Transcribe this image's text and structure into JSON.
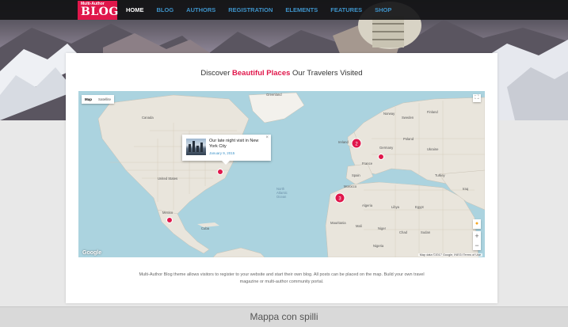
{
  "nav": {
    "logo_small": "Multi-Author",
    "logo_big": "BLOG",
    "items": [
      "HOME",
      "BLOG",
      "AUTHORS",
      "REGISTRATION",
      "ELEMENTS",
      "FEATURES",
      "SHOP"
    ]
  },
  "section": {
    "title_before": "Discover ",
    "title_highlight": "Beautiful Places",
    "title_after": " Our Travelers Visited"
  },
  "map": {
    "type_map": "Map",
    "type_satellite": "Satellite",
    "fullscreen_icon": "fullscreen-icon",
    "zoom_in": "+",
    "zoom_out": "−",
    "google_logo": "Google",
    "attribution": "Map data ©2017 Google, INEGI   Terms of Use",
    "labels": {
      "greenland": "Greenland",
      "canada": "Canada",
      "united_states": "United States",
      "mexico": "Mexico",
      "ocean": "North\nAtlantic\nOcean",
      "ireland": "Ireland",
      "germany": "Germany",
      "france": "France",
      "spain": "Spain",
      "morocco": "Morocco",
      "algeria": "Algeria",
      "libya": "Libya",
      "egypt": "Egypt",
      "mali": "Mali",
      "niger": "Niger",
      "chad": "Chad",
      "sudan": "Sudan",
      "nigeria": "Nigeria",
      "mauritania": "Mauritania",
      "poland": "Poland",
      "ukraine": "Ukraine",
      "turkey": "Turkey",
      "iraq": "Iraq",
      "norway": "Norway",
      "sweden": "Sweden",
      "finland": "Finland",
      "cuba": "Cuba"
    },
    "clusters": [
      {
        "count": "2"
      },
      {
        "count": "3"
      }
    ],
    "infowindow": {
      "title": "Our late night visit in New York City",
      "date": "January 9, 2015",
      "close": "×"
    }
  },
  "description": "Multi-Author Blog theme allows visitors to register to your website and start their own blog. All posts can be placed on the map. Build your own travel magazine or multi-author community portal.",
  "caption": "Mappa con spilli",
  "colors": {
    "accent": "#e0174b",
    "nav_link": "#3e93c9",
    "water": "#abd3df",
    "land": "#e9e5dc"
  }
}
